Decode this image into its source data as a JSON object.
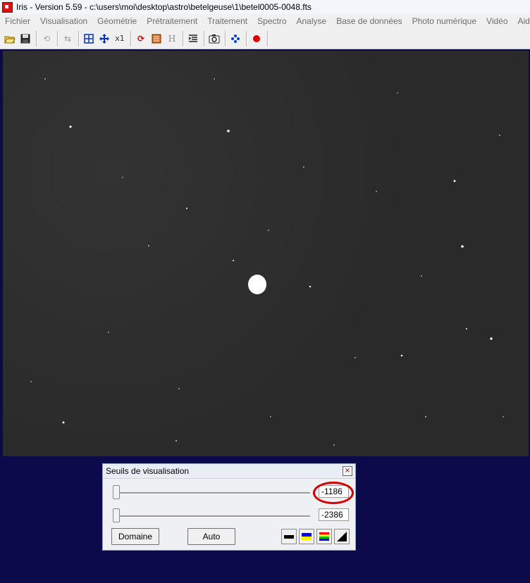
{
  "window": {
    "title": "Iris - Version 5.59 - c:\\users\\moi\\desktop\\astro\\betelgeuse\\1\\betel0005-0048.fts"
  },
  "menu": [
    "Fichier",
    "Visualisation",
    "Géométrie",
    "Prétraitement",
    "Traitement",
    "Spectro",
    "Analyse",
    "Base de données",
    "Photo numérique",
    "Vidéo",
    "Aide"
  ],
  "toolbar": {
    "x1_label": "x1",
    "h_label": "H"
  },
  "dialog": {
    "title": "Seuils de visualisation",
    "high_threshold": "-1186",
    "low_threshold": "-2386",
    "domaine_label": "Domaine",
    "auto_label": "Auto"
  },
  "colors": {
    "highlight": "#d40000",
    "background": "#0b0a4a"
  }
}
